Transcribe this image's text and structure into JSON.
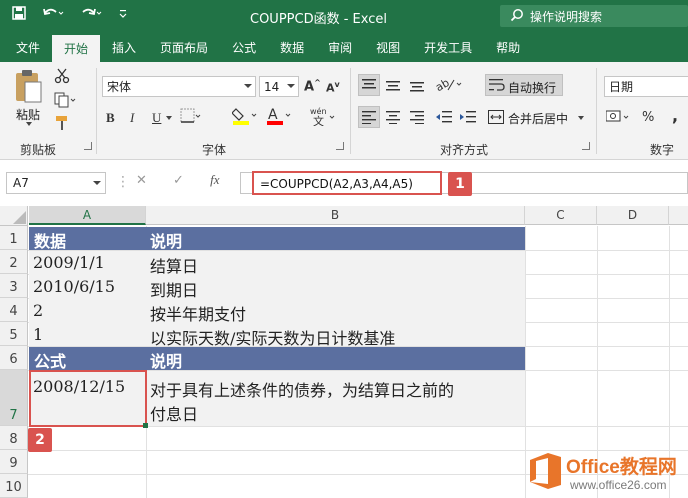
{
  "window": {
    "title": "COUPPCD函数  -  Excel"
  },
  "tell_me": {
    "label": "操作说明搜索"
  },
  "tabs": [
    "文件",
    "开始",
    "插入",
    "页面布局",
    "公式",
    "数据",
    "审阅",
    "视图",
    "开发工具",
    "帮助"
  ],
  "ribbon": {
    "paste_label": "粘贴",
    "clipboard_group": "剪贴板",
    "font_group": "字体",
    "align_group": "对齐方式",
    "number_group": "数字",
    "font_name": "宋体",
    "font_size": "14",
    "wrap_text": "自动换行",
    "merge_center": "合并后居中",
    "number_format": "日期",
    "bold": "B",
    "italic": "I",
    "underline": "U",
    "font_color": "A",
    "grow_font": "A",
    "shrink_font": "A",
    "percent": "%",
    "comma": ","
  },
  "formula_bar": {
    "name_box": "A7",
    "formula": "=COUPPCD(A2,A3,A4,A5)",
    "fx": "fx"
  },
  "columns": [
    "A",
    "B",
    "C",
    "D"
  ],
  "rows": [
    "1",
    "2",
    "3",
    "4",
    "5",
    "6",
    "7",
    "8",
    "9",
    "10"
  ],
  "cells": {
    "r1": {
      "a": "数据",
      "b": "说明"
    },
    "r2": {
      "a": "2009/1/1",
      "b": "结算日"
    },
    "r3": {
      "a": "2010/6/15",
      "b": "到期日"
    },
    "r4": {
      "a": "2",
      "b": "按半年期支付"
    },
    "r5": {
      "a": "1",
      "b": "以实际天数/实际天数为日计数基准"
    },
    "r6": {
      "a": "公式",
      "b": "说明"
    },
    "r7": {
      "a": "2008/12/15",
      "b_line1": "对于具有上述条件的债券，为结算日之前的",
      "b_line2": "付息日"
    }
  },
  "badges": {
    "first": "1",
    "second": "2"
  },
  "watermark": {
    "brand": "Office教程网",
    "url": "www.office26.com"
  },
  "colors": {
    "excel_green": "#217346",
    "header_fill": "#5b6fa0",
    "highlight_red": "#d9534f",
    "brand_orange": "#e8752a"
  }
}
